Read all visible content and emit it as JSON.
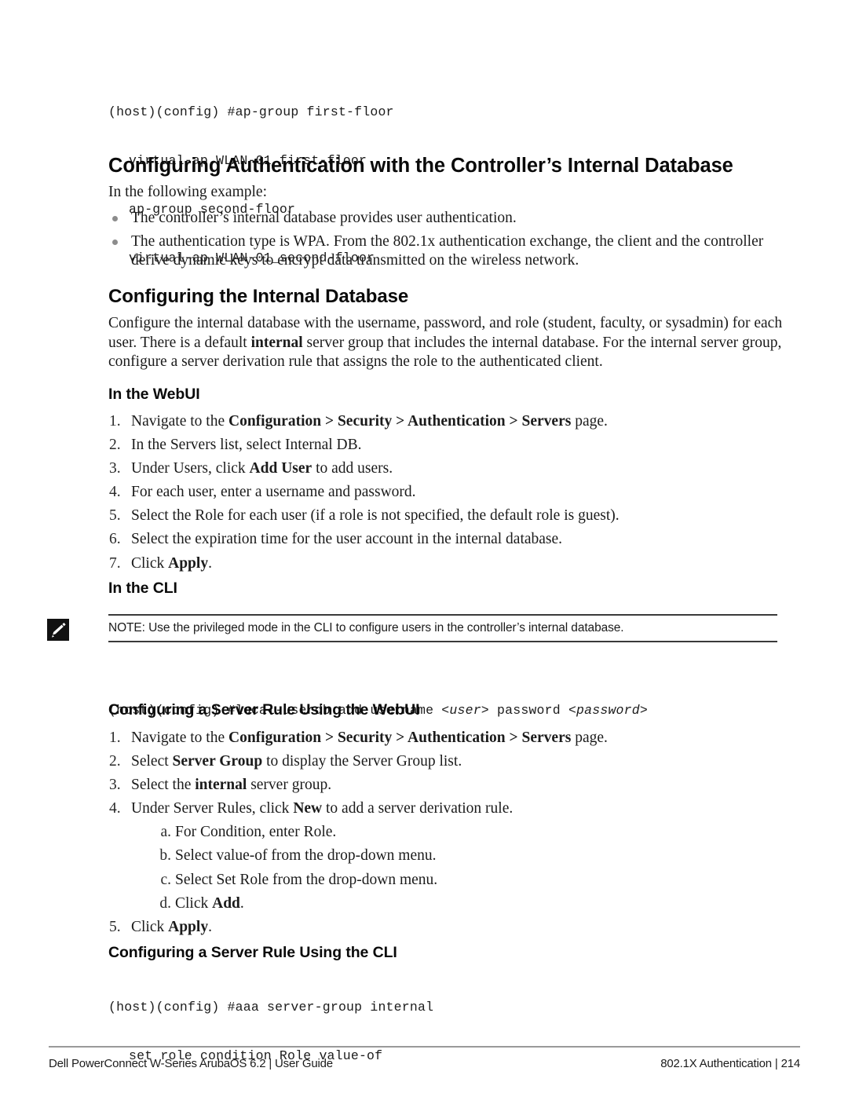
{
  "page": {
    "number": "214",
    "footer_left": "Dell PowerConnect W-Series ArubaOS 6.2 | User Guide",
    "footer_right": "802.1X Authentication  |  214"
  },
  "top_code": {
    "lines": [
      "(host)(config) #ap-group first-floor",
      "virtual-ap WLAN-01_first-floor",
      "ap-group second-floor",
      "virtual-ap WLAN-01_second-floor"
    ]
  },
  "section_auth": {
    "heading": "Configuring Authentication with the Controller’s Internal Database",
    "intro": "In the following example:",
    "bullets": [
      "The controller’s internal database provides user authentication.",
      "The authentication type is WPA. From the 802.1x authentication exchange, the client and the controller derive dynamic keys to encrypt data transmitted on the wireless network."
    ]
  },
  "section_internal_db": {
    "heading": "Configuring the Internal Database",
    "paragraph_part1": "Configure the internal database with the username, password, and role (student, faculty, or sysadmin) for each user. There is a default ",
    "paragraph_bold": "internal",
    "paragraph_part2": " server group that includes the internal database. For the internal server group, configure a server derivation rule that assigns the role to the authenticated client.",
    "webui_heading": "In the WebUI",
    "webui_steps": [
      {
        "marker": "1.",
        "pre": "Navigate to the ",
        "bold": "Configuration > Security > Authentication > Servers",
        "post": " page."
      },
      {
        "marker": "2.",
        "pre": "In the Servers list, select Internal DB.",
        "bold": "",
        "post": ""
      },
      {
        "marker": "3.",
        "pre": "Under Users, click ",
        "bold": "Add User",
        "post": " to add users."
      },
      {
        "marker": "4.",
        "pre": "For each user, enter a username and password.",
        "bold": "",
        "post": ""
      },
      {
        "marker": "5.",
        "pre": "Select the Role for each user (if a role is not specified, the default role is guest).",
        "bold": "",
        "post": ""
      },
      {
        "marker": "6.",
        "pre": "Select the expiration time for the user account in the internal database.",
        "bold": "",
        "post": ""
      },
      {
        "marker": "7.",
        "pre": "Click ",
        "bold": "Apply",
        "post": "."
      }
    ],
    "cli_heading": "In the CLI",
    "note_icon": "note-pencil-icon",
    "note_text": "NOTE: Use the privileged mode in the CLI to configure users in the controller’s internal database.",
    "cli_code": {
      "prefix": "(host)(config) #local-userdb add username ",
      "arg1": "<user>",
      "middle": " password ",
      "arg2": "<password>"
    }
  },
  "section_rule_webui": {
    "heading": "Configuring a Server Rule Using the WebUI",
    "steps": [
      {
        "marker": "1.",
        "pre": "Navigate to the ",
        "bold": "Configuration > Security > Authentication > Servers",
        "post": " page."
      },
      {
        "marker": "2.",
        "pre": "Select ",
        "bold": "Server Group",
        "post": " to display the Server Group list."
      },
      {
        "marker": "3.",
        "pre": "Select the ",
        "bold": "internal",
        "post": " server group."
      },
      {
        "marker": "4.",
        "pre": "Under Server Rules, click ",
        "bold": "New",
        "post": " to add a server derivation rule."
      }
    ],
    "substeps": [
      {
        "marker": "a.",
        "pre": "For Condition, enter Role.",
        "bold": "",
        "post": ""
      },
      {
        "marker": "b.",
        "pre": "Select value-of from the drop-down menu.",
        "bold": "",
        "post": ""
      },
      {
        "marker": "c.",
        "pre": "Select Set Role from the drop-down menu.",
        "bold": "",
        "post": ""
      },
      {
        "marker": "d.",
        "pre": "Click ",
        "bold": "Add",
        "post": "."
      }
    ],
    "final_step": {
      "marker": "5.",
      "pre": "Click ",
      "bold": "Apply",
      "post": "."
    }
  },
  "section_rule_cli": {
    "heading": "Configuring a Server Rule Using the CLI",
    "lines": [
      "(host)(config) #aaa server-group internal",
      "set role condition Role value-of"
    ]
  },
  "colors": {
    "text": "#1b1b1b",
    "heading": "#0a0a0a",
    "bullet": "#8c8c8c",
    "rule": "#3a3a3a",
    "footer_rule": "#9a9a9a"
  }
}
